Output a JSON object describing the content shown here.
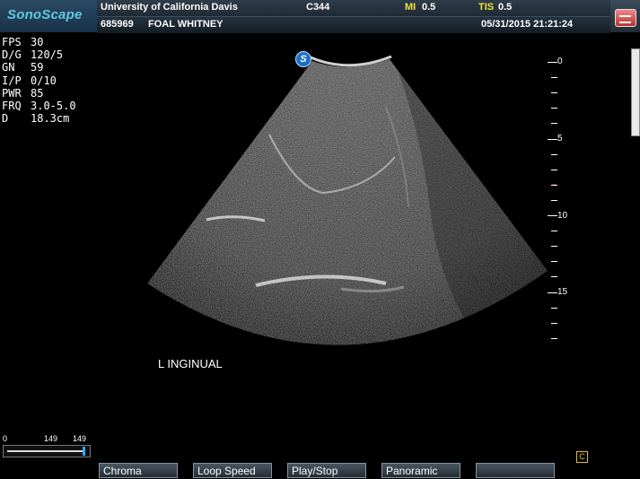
{
  "header": {
    "brand": "SonoScape",
    "hospital": "University of California Davis",
    "probe": "C344",
    "mi_label": "MI",
    "mi_value": "0.5",
    "tis_label": "TIS",
    "tis_value": "0.5",
    "patient_id": "685969",
    "patient_name": "FOAL WHITNEY",
    "datetime": "05/31/2015 21:21:24",
    "menu_icon": "settings-menu-icon"
  },
  "params": [
    {
      "key": "FPS",
      "value": "30"
    },
    {
      "key": "D/G",
      "value": "120/5"
    },
    {
      "key": "GN",
      "value": "59"
    },
    {
      "key": "I/P",
      "value": "0/10"
    },
    {
      "key": "PWR",
      "value": "85"
    },
    {
      "key": "FRQ",
      "value": "3.0-5.0"
    },
    {
      "key": "D",
      "value": "18.3cm"
    }
  ],
  "image": {
    "orientation_marker": "S",
    "annotation": "L INGINUAL"
  },
  "depth_scale": {
    "labels": [
      "0",
      "5",
      "10",
      "15"
    ],
    "focus_marker": "→",
    "focus_color": "#ff3030"
  },
  "gray_scale": {
    "min": "0",
    "mid": "149",
    "max": "149"
  },
  "badge": "C",
  "buttons": [
    "Chroma",
    "Loop Speed",
    "Play/Stop",
    "Panoramic",
    ""
  ]
}
